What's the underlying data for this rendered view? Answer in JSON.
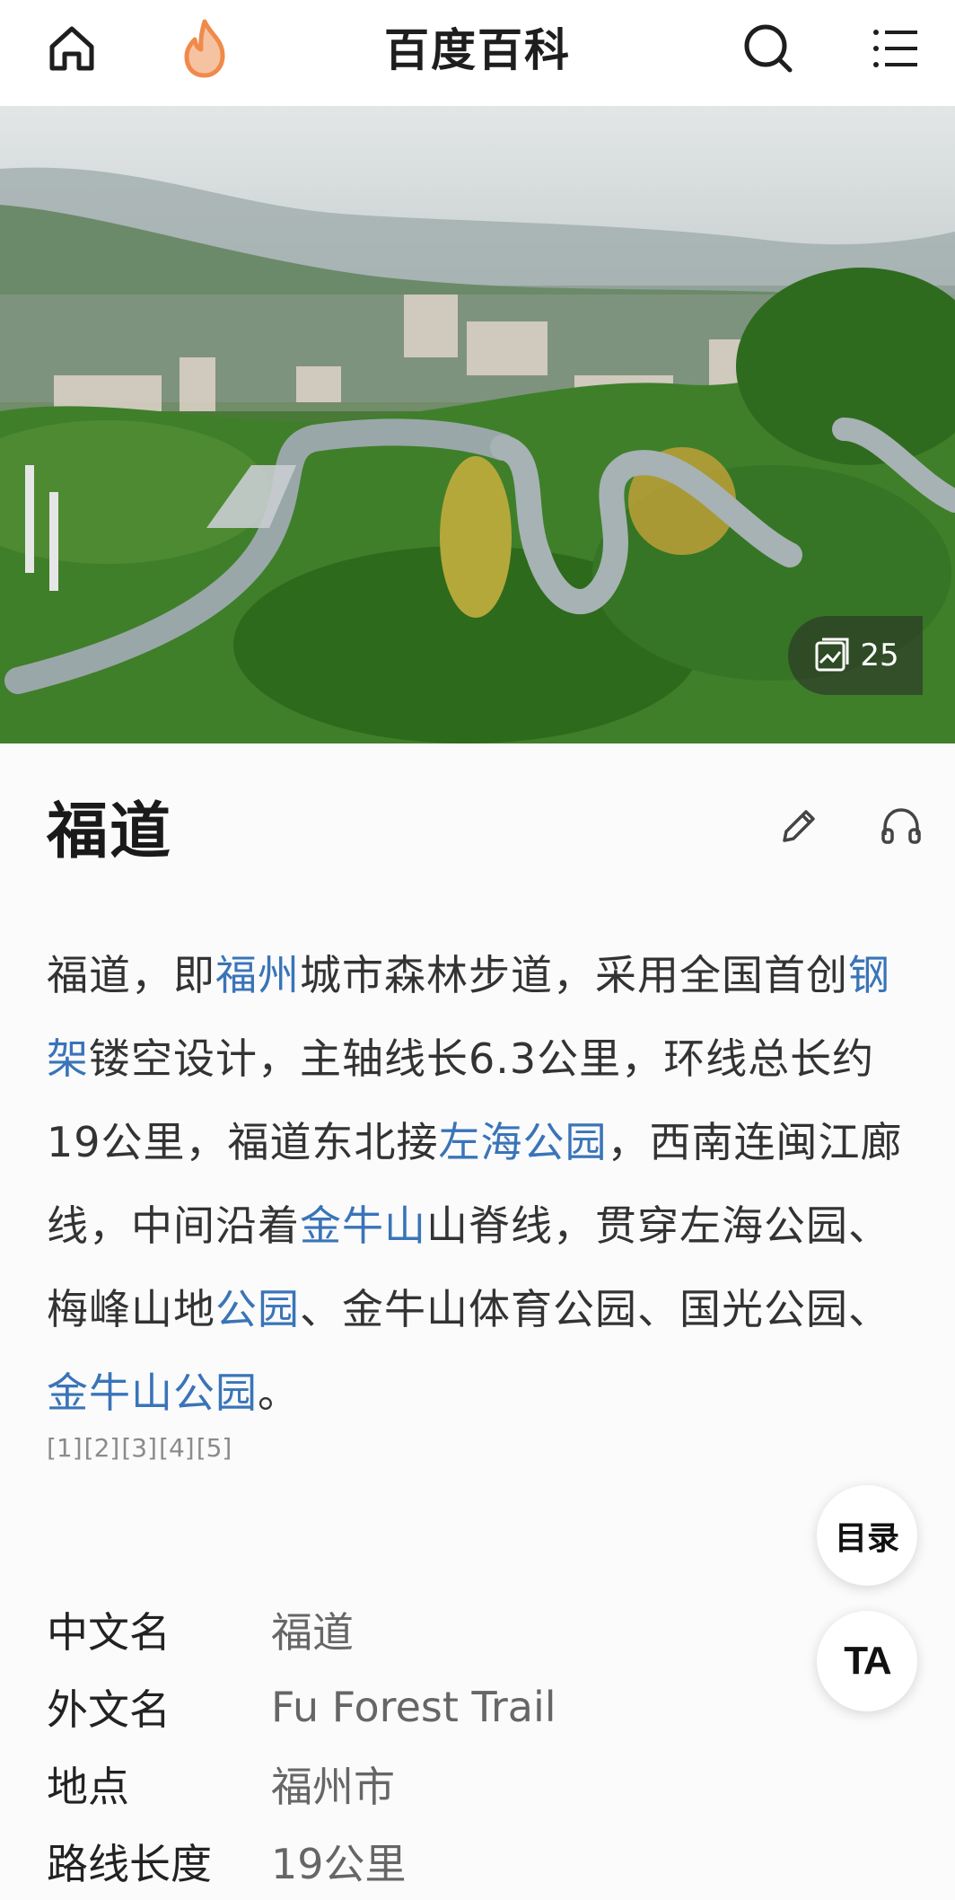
{
  "header": {
    "title": "百度百科",
    "icons": [
      "home-icon",
      "flame-icon",
      "search-icon",
      "menu-icon"
    ],
    "accent": "#f08a4b"
  },
  "hero": {
    "gallery_count": "25"
  },
  "entry": {
    "title": "福道",
    "summary": [
      {
        "t": "福道，即"
      },
      {
        "t": "福州",
        "link": true
      },
      {
        "t": "城市森林步道，采用全国首创"
      },
      {
        "t": "钢架",
        "link": true
      },
      {
        "t": "镂空设计，主轴线长6.3公里，环线总长约19公里，福道东北接"
      },
      {
        "t": "左海公园",
        "link": true
      },
      {
        "t": "，西南连闽江廊线，中间沿着"
      },
      {
        "t": "金牛山",
        "link": true
      },
      {
        "t": "山脊线，贯穿左海公园、梅峰山地"
      },
      {
        "t": "公园",
        "link": true
      },
      {
        "t": "、金牛山体育公园、国光公园、"
      },
      {
        "t": "金牛山公园",
        "link": true
      },
      {
        "t": "。"
      }
    ],
    "refs": [
      "[1]",
      "[2]",
      "[3]",
      "[4]",
      "[5]"
    ]
  },
  "floating": {
    "toc_label": "目录",
    "ta_label": "TA"
  },
  "infobox": [
    {
      "key": "中文名",
      "value": "福道"
    },
    {
      "key": "外文名",
      "value": "Fu Forest Trail"
    },
    {
      "key": "地点",
      "value": "福州市"
    },
    {
      "key": "路线长度",
      "value": "19公里"
    }
  ],
  "colors": {
    "link": "#3a74b8",
    "text": "#333333"
  }
}
